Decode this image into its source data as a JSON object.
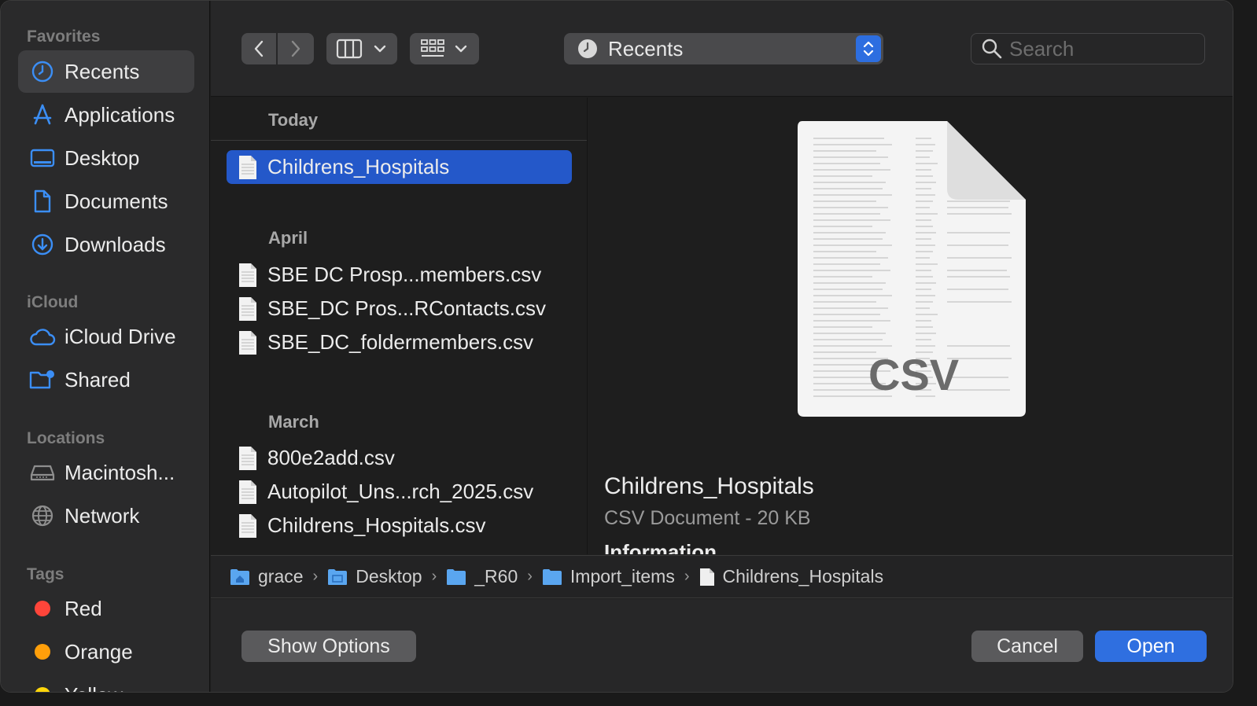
{
  "sidebar": {
    "favorites_title": "Favorites",
    "icloud_title": "iCloud",
    "locations_title": "Locations",
    "tags_title": "Tags",
    "favorites": [
      {
        "label": "Recents"
      },
      {
        "label": "Applications"
      },
      {
        "label": "Desktop"
      },
      {
        "label": "Documents"
      },
      {
        "label": "Downloads"
      }
    ],
    "icloud": [
      {
        "label": "iCloud Drive"
      },
      {
        "label": "Shared"
      }
    ],
    "locations": [
      {
        "label": "Macintosh..."
      },
      {
        "label": "Network"
      }
    ],
    "tags": [
      {
        "label": "Red",
        "color": "#ff453a"
      },
      {
        "label": "Orange",
        "color": "#ff9f0a"
      },
      {
        "label": "Yellow",
        "color": "#ffd60a"
      }
    ]
  },
  "toolbar": {
    "location": "Recents",
    "search_placeholder": "Search"
  },
  "list": {
    "groups": [
      {
        "title": "Today",
        "files": [
          "Childrens_Hospitals"
        ]
      },
      {
        "title": "April",
        "files": [
          "SBE DC Prosp...members.csv",
          "SBE_DC Pros...RContacts.csv",
          "SBE_DC_foldermembers.csv"
        ]
      },
      {
        "title": "March",
        "files": [
          "800e2add.csv",
          "Autopilot_Uns...rch_2025.csv",
          "Childrens_Hospitals.csv"
        ]
      }
    ]
  },
  "preview": {
    "icon_label": "CSV",
    "title": "Childrens_Hospitals",
    "subtitle": "CSV Document - 20 KB",
    "info_heading": "Information"
  },
  "path": [
    "grace",
    "Desktop",
    "_R60",
    "Import_items",
    "Childrens_Hospitals"
  ],
  "buttons": {
    "show_options": "Show Options",
    "cancel": "Cancel",
    "open": "Open"
  },
  "colors": {
    "accent": "#2f6fe0",
    "selection": "#2458c9"
  }
}
